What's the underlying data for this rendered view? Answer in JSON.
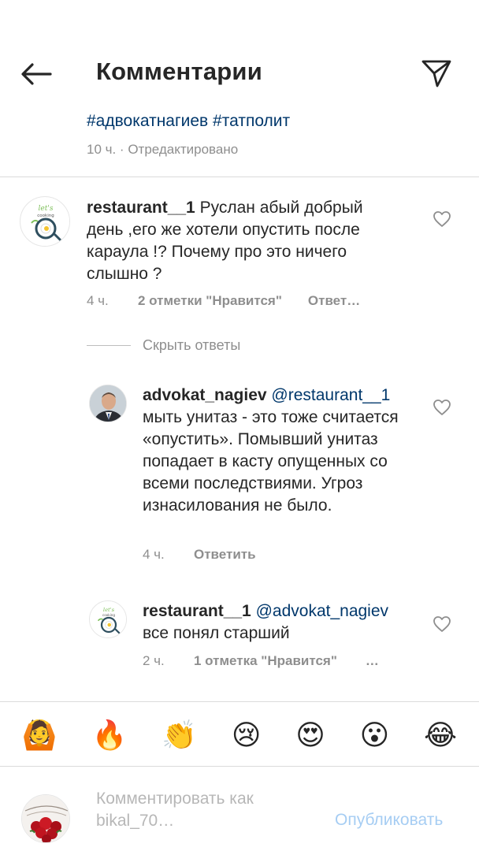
{
  "header": {
    "title": "Комментарии"
  },
  "caption": {
    "hashtags": [
      "#адвокатнагиев",
      "#татполит"
    ],
    "meta": "10 ч. · Отредактировано"
  },
  "comments": [
    {
      "user": "restaurant__1",
      "text": " Руслан абый добрый день ,его же хотели опустить после караула !? Почему про это ничего слышно ?",
      "time": "4 ч.",
      "likes": "2 отметки \"Нравится\"",
      "reply": "Ответ…",
      "avatar_text": "let's cooking"
    }
  ],
  "hide_replies_label": "Скрыть ответы",
  "replies": [
    {
      "user": "advokat_nagiev",
      "mention": "@restaurant__1",
      "text": " мыть унитаз - это тоже считается «опустить». Помывший унитаз попадает в касту опущенных со всеми последствиями. Угроз изнасилования не было.",
      "time": "4 ч.",
      "reply": "Ответить"
    },
    {
      "user": "restaurant__1",
      "mention": "@advokat_nagiev",
      "text": " все понял старший",
      "time": "2 ч.",
      "likes": "1 отметка \"Нравится\"",
      "more": "…",
      "avatar_text": "let's cooking"
    }
  ],
  "emojis": [
    "🙆",
    "🔥",
    "👏",
    "😢",
    "😍",
    "😮",
    "😂"
  ],
  "composer": {
    "placeholder": "Комментировать как bikal_70…",
    "publish_label": "Опубликовать"
  },
  "colors": {
    "link": "#00376b",
    "meta": "#8e8e8e",
    "publish_disabled": "#a6cdf3",
    "divider": "#dbdbdb"
  }
}
